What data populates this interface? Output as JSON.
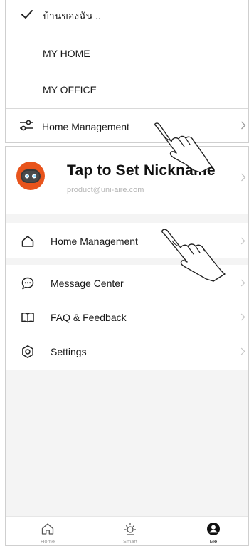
{
  "home_switcher": {
    "homes": [
      {
        "name": "บ้านของฉัน ..",
        "selected": true
      },
      {
        "name": "MY HOME",
        "selected": false
      },
      {
        "name": "MY OFFICE",
        "selected": false
      }
    ],
    "management_label": "Home Management",
    "management_icon": "sliders-icon",
    "chevron_icon": "chevron-right-icon"
  },
  "me_page": {
    "profile": {
      "nickname": "Tap to Set Nickname",
      "email": "product@uni-aire.com",
      "avatar_color": "#e8541c"
    },
    "menu_primary": [
      {
        "label": "Home Management",
        "icon": "house-outline-icon"
      }
    ],
    "menu_secondary": [
      {
        "label": "Message Center",
        "icon": "chat-bubble-icon"
      },
      {
        "label": "FAQ & Feedback",
        "icon": "book-icon"
      },
      {
        "label": "Settings",
        "icon": "gear-icon"
      }
    ]
  },
  "tabbar": {
    "tabs": [
      {
        "label": "Home",
        "icon": "house-outline-icon",
        "active": false
      },
      {
        "label": "Smart",
        "icon": "sun-icon",
        "active": false
      },
      {
        "label": "Me",
        "icon": "person-icon",
        "active": true
      }
    ]
  },
  "colors": {
    "accent": "#e8541c",
    "background": "#f4f4f4",
    "text": "#1a1a1a",
    "muted": "#b5b5b5"
  }
}
